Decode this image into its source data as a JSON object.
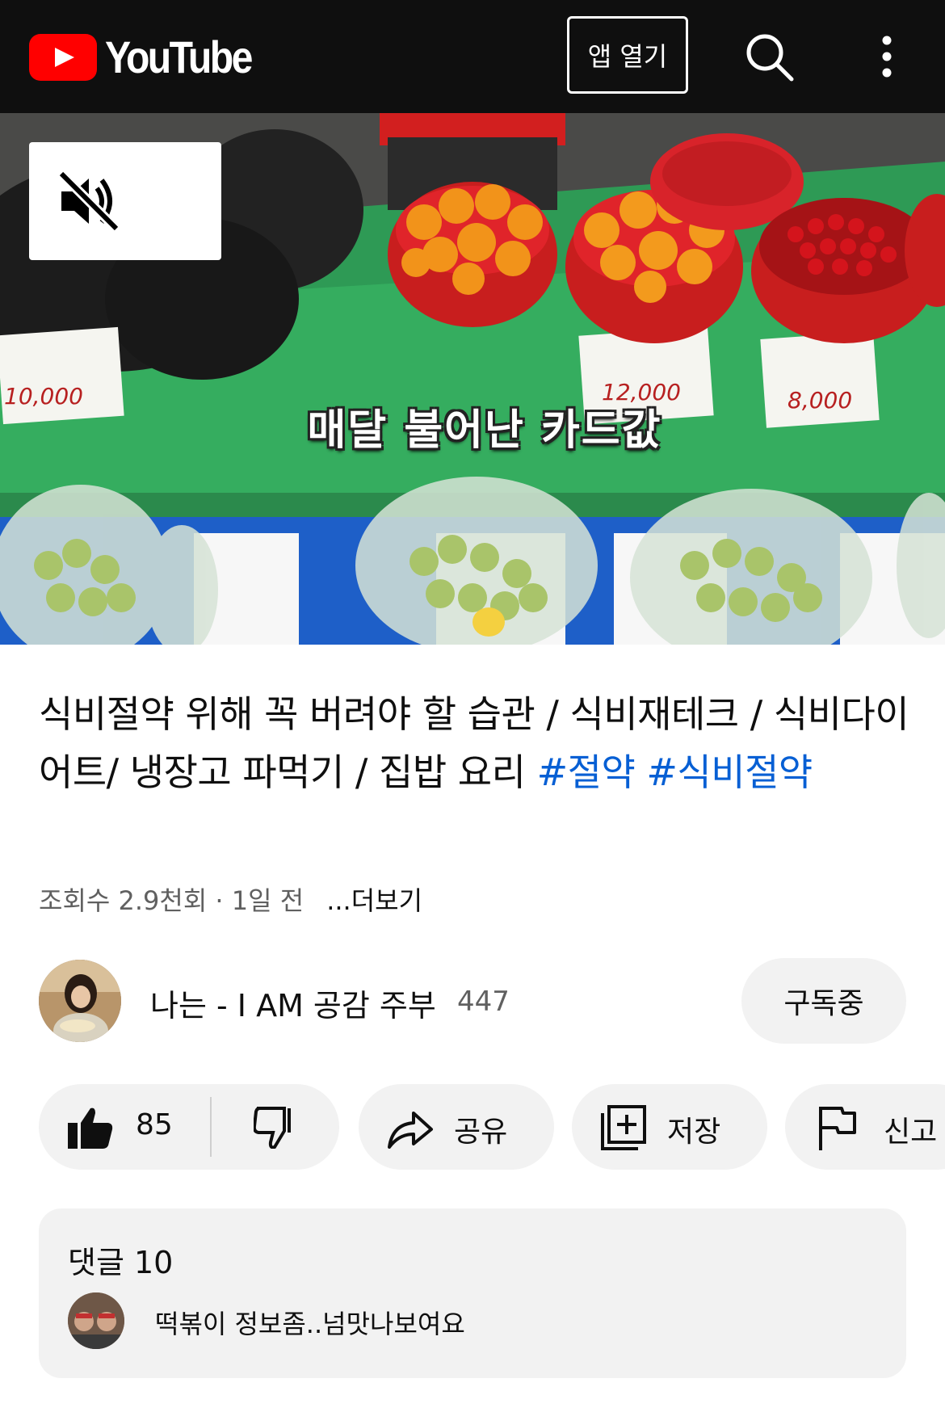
{
  "header": {
    "logo_text": "YouTube",
    "open_app_label": "앱 열기",
    "search_icon": "search-icon",
    "more_icon": "more-vert-icon"
  },
  "video": {
    "subtitle": "매달 불어난 카드값",
    "mute_icon": "volume-off-icon",
    "price_tags": [
      "10,000",
      "12,000",
      "8,000"
    ]
  },
  "title": {
    "text": "식비절약 위해 꼭 버려야 할 습관 / 식비재테크 / 식비다이어트/ 냉장고 파먹기 / 집밥 요리 ",
    "hashtags": [
      "#절약",
      "#식비절약"
    ]
  },
  "meta": {
    "views_and_date": "조회수 2.9천회 · 1일 전",
    "more_label": "...더보기"
  },
  "channel": {
    "name": "나는 - I AM 공감 주부",
    "subscribers": "447",
    "subscribe_label": "구독중"
  },
  "actions": {
    "like_count": "85",
    "share_label": "공유",
    "save_label": "저장",
    "report_label": "신고"
  },
  "comments": {
    "title": "댓글 10",
    "top_comment": "떡볶이 정보좀..넘맛나보여요"
  },
  "colors": {
    "header_bg": "#0f0f0f",
    "brand_red": "#ff0000",
    "hashtag_blue": "#065fd4",
    "pill_bg": "#f2f2f2"
  }
}
